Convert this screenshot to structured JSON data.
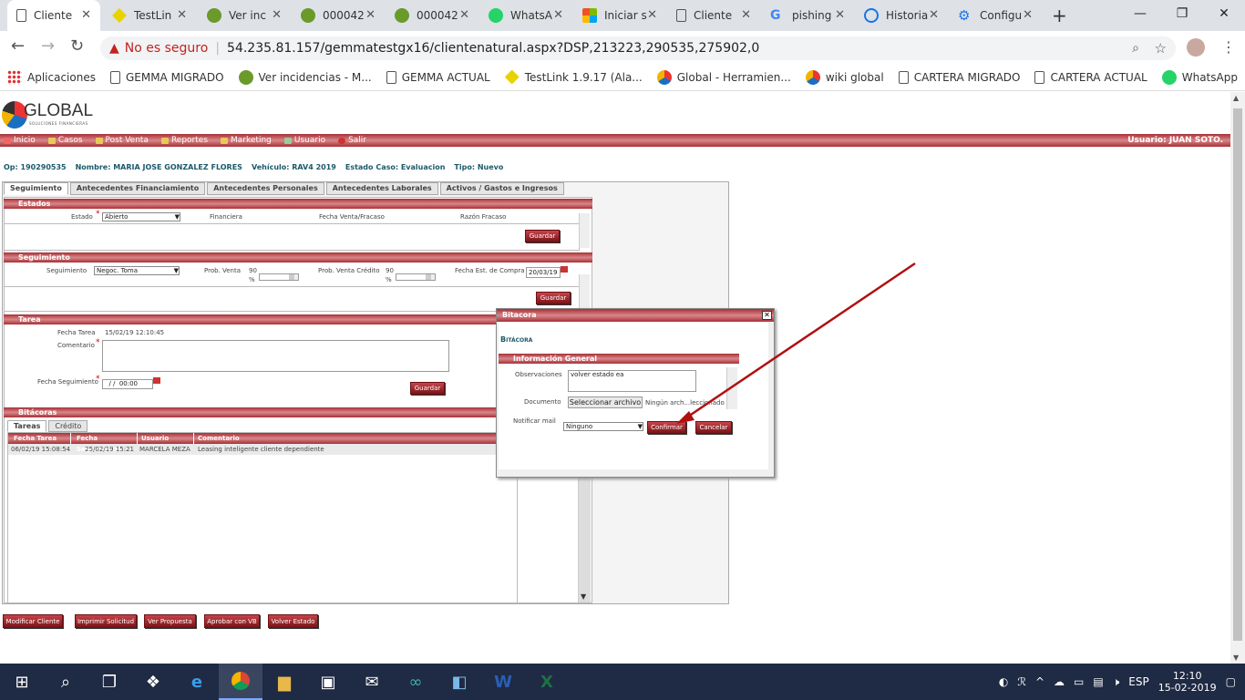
{
  "browser": {
    "tabs": [
      {
        "label": "Cliente",
        "icon": "document-icon",
        "active": true
      },
      {
        "label": "TestLin",
        "icon": "testlink-icon"
      },
      {
        "label": "Ver inc",
        "icon": "mantis-icon"
      },
      {
        "label": "000042",
        "icon": "mantis-icon"
      },
      {
        "label": "000042",
        "icon": "mantis-icon"
      },
      {
        "label": "WhatsA",
        "icon": "whatsapp-icon"
      },
      {
        "label": "Iniciar s",
        "icon": "microsoft-icon"
      },
      {
        "label": "Cliente",
        "icon": "document-icon"
      },
      {
        "label": "pishing",
        "icon": "google-icon"
      },
      {
        "label": "Historia",
        "icon": "history-icon"
      },
      {
        "label": "Configu",
        "icon": "gear-icon"
      }
    ],
    "security_label": "No es seguro",
    "url": "54.235.81.157/gemmatestgx16/clientenatural.aspx?DSP,213223,290535,275902,0",
    "bookmarks": [
      {
        "label": "Aplicaciones",
        "icon": "apps-grid-icon"
      },
      {
        "label": "GEMMA MIGRADO",
        "icon": "document-icon"
      },
      {
        "label": "Ver incidencias - M...",
        "icon": "mantis-icon"
      },
      {
        "label": "GEMMA ACTUAL",
        "icon": "document-icon"
      },
      {
        "label": "TestLink 1.9.17 (Ala...",
        "icon": "testlink-icon"
      },
      {
        "label": "Global - Herramien...",
        "icon": "global-icon"
      },
      {
        "label": "wiki global",
        "icon": "global-icon"
      },
      {
        "label": "CARTERA MIGRADO",
        "icon": "document-icon"
      },
      {
        "label": "CARTERA ACTUAL",
        "icon": "document-icon"
      },
      {
        "label": "WhatsApp",
        "icon": "whatsapp-icon"
      }
    ]
  },
  "app": {
    "logo_text": "GLOBAL",
    "logo_sub": "SOLUCIONES FINANCIERAS",
    "menu": [
      "Inicio",
      "Casos",
      "Post Venta",
      "Reportes",
      "Marketing",
      "Usuario",
      "Salir"
    ],
    "user": "Usuario: JUAN SOTO.",
    "header_fields": [
      "Op: 190290535",
      "Nombre: MARIA JOSE GONZALEZ FLORES",
      "Vehículo: RAV4 2019",
      "Estado Caso: Evaluacion",
      "Tipo: Nuevo"
    ],
    "page_tabs": [
      "Seguimiento",
      "Antecedentes Financiamiento",
      "Antecedentes Personales",
      "Antecedentes Laborales",
      "Activos / Gastos e Ingresos"
    ],
    "estados": {
      "title": "Estados",
      "estado_label": "Estado",
      "estado_value": "Abierto",
      "financiera_label": "Financiera",
      "fecha_venta_label": "Fecha Venta/Fracaso",
      "razon_label": "Razón Fracaso",
      "save": "Guardar"
    },
    "seguimiento": {
      "title": "Seguimiento",
      "seg_label": "Seguimiento",
      "seg_value": "Negoc. Toma",
      "prob_venta_label": "Prob. Venta",
      "prob_venta_value": "90",
      "prob_venta_pct": 0.9,
      "prob_credito_label": "Prob. Venta Crédito",
      "prob_credito_value": "90",
      "prob_credito_pct": 0.9,
      "pct_sign": "%",
      "fecha_compra_label": "Fecha Est. de Compra",
      "fecha_compra_value": "20/03/19",
      "save": "Guardar"
    },
    "tarea": {
      "title": "Tarea",
      "fecha_label": "Fecha Tarea",
      "fecha_value": "15/02/19 12:10:45",
      "comentario_label": "Comentario",
      "fecha_seg_label": "Fecha Seguimiento",
      "fecha_seg_value": "  / /  00:00",
      "save": "Guardar"
    },
    "bitacoras": {
      "title": "Bitácoras",
      "subtabs": [
        "Tareas",
        "Crédito"
      ],
      "columns": [
        "Fecha Tarea",
        "Fecha Seguimiento",
        "Usuario",
        "Comentario"
      ],
      "rows": [
        [
          "06/02/19 15:08:54",
          "25/02/19 15:21",
          "MARCELA MEZA",
          "Leasing inteligente cliente dependiente"
        ]
      ]
    },
    "bottom_buttons": [
      "Modificar Cliente",
      "Imprimir Solicitud",
      "Ver Propuesta",
      "Aprobar con VB",
      "Volver Estado"
    ]
  },
  "modal": {
    "title": "Bitacora",
    "heading": "Bitácora",
    "section": "Información General",
    "obs_label": "Observaciones",
    "obs_value": "volver estado ea",
    "doc_label": "Documento",
    "file_button": "Seleccionar archivo",
    "file_status": "Ningún arch...leccionado",
    "mail_label": "Notificar mail",
    "mail_value": "Ninguno",
    "confirm": "Confirmar",
    "cancel": "Cancelar"
  },
  "taskbar": {
    "lang": "ESP",
    "time": "12:10",
    "date": "15-02-2019"
  },
  "colors": {
    "accent_red": "#a73036",
    "teal_text": "#1a5a6a",
    "annotation_arrow": "#b01010"
  }
}
